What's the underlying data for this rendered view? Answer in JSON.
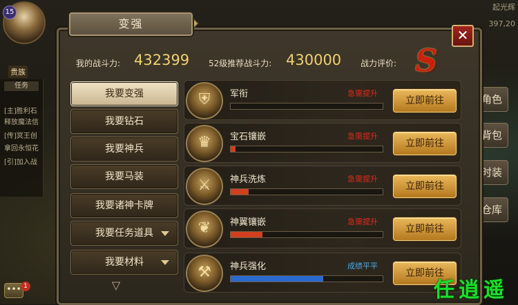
{
  "hud": {
    "level": "15",
    "guild": "贵族",
    "task_tab": "任务",
    "chat_lines": [
      "[主]胜利石",
      "释放魔法信",
      "[传]冥王创",
      "拿回永恒花",
      "[引]加入战"
    ],
    "chat_btn": "•••",
    "chat_badge": "1",
    "top_right_name": "起光辉",
    "top_right_number": "397,20",
    "right_buttons": [
      "角色",
      "背包",
      "时装",
      "仓库"
    ],
    "watermark": "任逍遥"
  },
  "dialog": {
    "title": "变强",
    "close_label": "✕",
    "stats": {
      "my_power_label": "我的战斗力:",
      "my_power_value": "432399",
      "recommended_label": "52级推荐战斗力:",
      "recommended_value": "430000",
      "rating_label": "战力评价:",
      "rating_grade": "S"
    },
    "menu": [
      {
        "label": "我要变强",
        "active": true,
        "dropdown": false
      },
      {
        "label": "我要钻石",
        "active": false,
        "dropdown": false
      },
      {
        "label": "我要神兵",
        "active": false,
        "dropdown": false
      },
      {
        "label": "我要马装",
        "active": false,
        "dropdown": false
      },
      {
        "label": "我要诸神卡牌",
        "active": false,
        "dropdown": false
      },
      {
        "label": "我要任务道具",
        "active": false,
        "dropdown": true
      },
      {
        "label": "我要材料",
        "active": false,
        "dropdown": true
      }
    ],
    "rows": [
      {
        "name": "军衔",
        "status": "急需提升",
        "status_type": "urgent",
        "progress": 0.0,
        "bar_color": "#d04020",
        "button": "立即前往",
        "icon": "rank-shield-icon"
      },
      {
        "name": "宝石镶嵌",
        "status": "急需提升",
        "status_type": "urgent",
        "progress": 0.03,
        "bar_color": "#d04020",
        "button": "立即前往",
        "icon": "gem-helmet-icon"
      },
      {
        "name": "神兵洗炼",
        "status": "急需提升",
        "status_type": "urgent",
        "progress": 0.12,
        "bar_color": "#d04020",
        "button": "立即前往",
        "icon": "weapon-refine-icon"
      },
      {
        "name": "神翼镶嵌",
        "status": "急需提升",
        "status_type": "urgent",
        "progress": 0.21,
        "bar_color": "#d04020",
        "button": "立即前往",
        "icon": "wing-emblem-icon"
      },
      {
        "name": "神兵强化",
        "status": "成绩平平",
        "status_type": "ok",
        "progress": 0.61,
        "bar_color": "#2a6ad0",
        "button": "立即前往",
        "icon": "weapon-enhance-icon"
      }
    ]
  }
}
